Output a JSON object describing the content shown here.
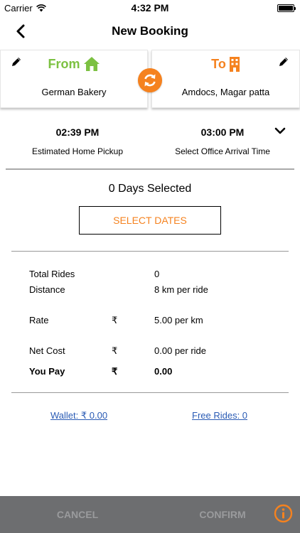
{
  "status_bar": {
    "carrier": "Carrier",
    "time": "4:32 PM"
  },
  "nav": {
    "title": "New Booking",
    "back_icon": "chevron-left-icon"
  },
  "from_card": {
    "label": "From",
    "location": "German Bakery",
    "icon": "home-icon",
    "color": "#7cc142"
  },
  "to_card": {
    "label": "To",
    "location": "Amdocs, Magar patta",
    "icon": "building-icon",
    "color": "#f5821f"
  },
  "swap_icon": "swap-icon",
  "times": {
    "pickup_time": "02:39 PM",
    "pickup_label": "Estimated Home Pickup",
    "arrival_time": "03:00 PM",
    "arrival_label": "Select Office Arrival Time"
  },
  "days": {
    "text": "0 Days Selected",
    "button": "SELECT DATES"
  },
  "summary": {
    "total_rides": {
      "label": "Total Rides",
      "value": "0"
    },
    "distance": {
      "label": "Distance",
      "value": "8 km per ride"
    },
    "rate": {
      "label": "Rate",
      "currency": "₹",
      "value": "5.00 per km"
    },
    "net_cost": {
      "label": "Net Cost",
      "currency": "₹",
      "value": "0.00 per ride"
    },
    "you_pay": {
      "label": "You Pay",
      "currency": "₹",
      "value": "0.00"
    }
  },
  "links": {
    "wallet": "Wallet:  ₹ 0.00",
    "free_rides": "Free Rides: 0"
  },
  "bottom": {
    "cancel": "CANCEL",
    "confirm": "CONFIRM",
    "bar_color": "#6d6e70",
    "accent": "#f5821f"
  }
}
